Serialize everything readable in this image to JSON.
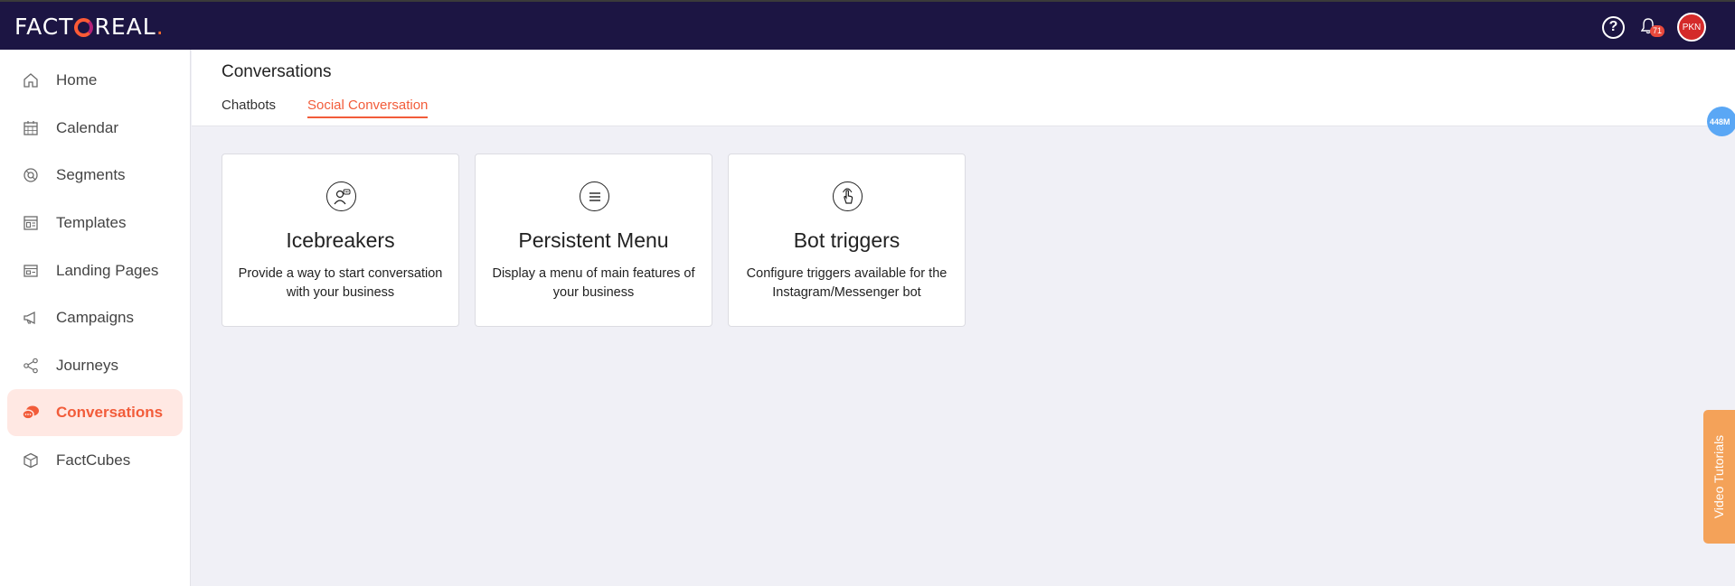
{
  "brand": {
    "logo_text_left": "FACT",
    "logo_text_right": "REAL",
    "logo_dot": "."
  },
  "topbar": {
    "help_label": "?",
    "notification_count": "71",
    "avatar_initials": "PKN"
  },
  "sidebar": {
    "items": [
      {
        "label": "Home",
        "icon": "home-icon"
      },
      {
        "label": "Calendar",
        "icon": "calendar-icon"
      },
      {
        "label": "Segments",
        "icon": "segments-icon"
      },
      {
        "label": "Templates",
        "icon": "templates-icon"
      },
      {
        "label": "Landing Pages",
        "icon": "landing-pages-icon"
      },
      {
        "label": "Campaigns",
        "icon": "megaphone-icon"
      },
      {
        "label": "Journeys",
        "icon": "share-nodes-icon"
      },
      {
        "label": "Conversations",
        "icon": "chat-bubbles-icon",
        "active": true
      },
      {
        "label": "FactCubes",
        "icon": "cube-icon"
      }
    ]
  },
  "header": {
    "title": "Conversations",
    "tabs": [
      {
        "label": "Chatbots",
        "active": false
      },
      {
        "label": "Social Conversation",
        "active": true
      }
    ]
  },
  "cards": [
    {
      "title": "Icebreakers",
      "description": "Provide a way to start conversation with your business",
      "icon": "person-chat-icon"
    },
    {
      "title": "Persistent Menu",
      "description": "Display a menu of main features of your business",
      "icon": "menu-lines-icon"
    },
    {
      "title": "Bot triggers",
      "description": "Configure triggers available for the Instagram/Messenger bot",
      "icon": "tap-hand-icon"
    }
  ],
  "memory_badge": "448M",
  "video_tutorials_label": "Video Tutorials",
  "colors": {
    "topbar": "#1c1543",
    "accent": "#f25c3a",
    "active_bg": "#ffe8e3",
    "video_tab": "#f4a259",
    "memory_badge": "#5aa7f5"
  }
}
